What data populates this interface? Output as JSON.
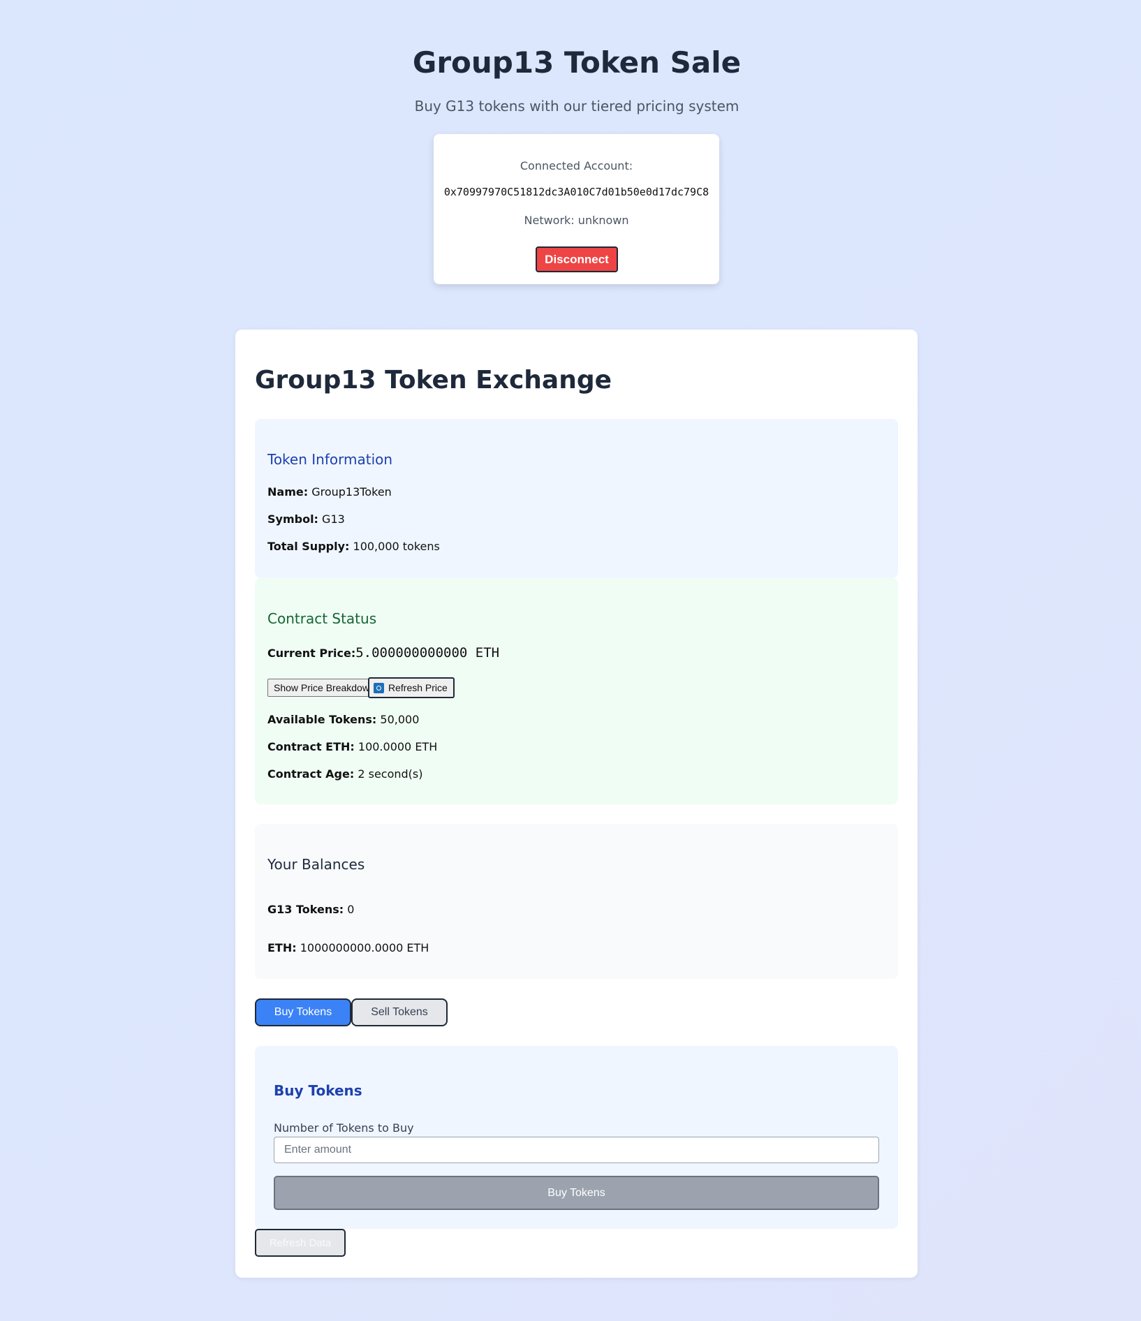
{
  "header": {
    "title": "Group13 Token Sale",
    "subtitle": "Buy G13 tokens with our tiered pricing system"
  },
  "account": {
    "label": "Connected Account:",
    "address": "0x70997970C51812dc3A010C7d01b50e0d17dc79C8",
    "network_label": "Network:",
    "network_value": "unknown",
    "disconnect_label": "Disconnect"
  },
  "exchange": {
    "title": "Group13 Token Exchange",
    "token_info": {
      "title": "Token Information",
      "name_label": "Name:",
      "name_value": "Group13Token",
      "symbol_label": "Symbol:",
      "symbol_value": "G13",
      "supply_label": "Total Supply:",
      "supply_value": "100,000 tokens"
    },
    "status": {
      "title": "Contract Status",
      "price_label": "Current Price:",
      "price_value": "5.000000000000 ETH",
      "breakdown_button": "Show Price Breakdown",
      "refresh_price_button": "Refresh Price",
      "available_label": "Available Tokens:",
      "available_value": "50,000",
      "eth_label": "Contract ETH:",
      "eth_value": "100.0000 ETH",
      "age_label": "Contract Age:",
      "age_value": "2 second(s)"
    },
    "balances": {
      "title": "Your Balances",
      "g13_label": "G13 Tokens:",
      "g13_value": "0",
      "eth_label": "ETH:",
      "eth_value": "1000000000.0000 ETH"
    },
    "tabs": [
      {
        "label": "Buy Tokens",
        "active": true
      },
      {
        "label": "Sell Tokens",
        "active": false
      }
    ],
    "buy_form": {
      "title": "Buy Tokens",
      "field_label": "Number of Tokens to Buy",
      "placeholder": "Enter amount",
      "value": "",
      "submit_label": "Buy Tokens"
    },
    "refresh_data_label": "Refresh Data"
  },
  "icons": {
    "refresh_price": "refresh-icon"
  },
  "colors": {
    "disconnect": "#ef4444",
    "active_tab": "#3b82f6",
    "disabled_button": "#9ca3af",
    "info_heading": "#1e40af",
    "status_heading": "#166534"
  }
}
